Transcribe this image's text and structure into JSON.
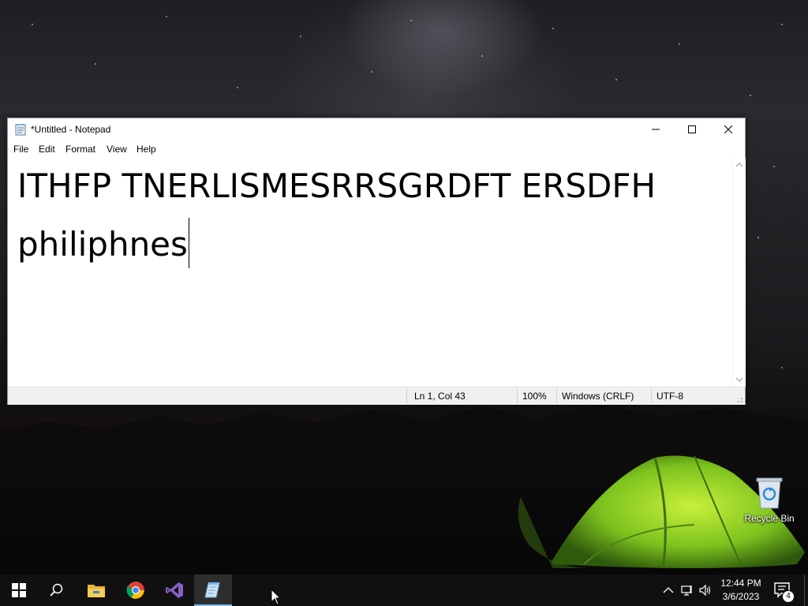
{
  "desktop": {
    "recycle_bin_label": "Recycle Bin"
  },
  "notepad": {
    "title": "*Untitled - Notepad",
    "menu": [
      "File",
      "Edit",
      "Format",
      "View",
      "Help"
    ],
    "content_lines": [
      "ITHFP TNERLISMESRRSGRDFT ERSDFH",
      "philiphnes"
    ],
    "status": {
      "position": "Ln 1, Col 43",
      "zoom": "100%",
      "line_ending": "Windows (CRLF)",
      "encoding": "UTF-8"
    }
  },
  "taskbar": {
    "pinned_apps": [
      "start-icon",
      "search-icon",
      "file-explorer-icon",
      "chrome-icon",
      "visual-studio-icon",
      "notepad-icon"
    ],
    "clock": {
      "time": "12:44 PM",
      "date": "3/6/2023"
    },
    "notification_count": "4"
  },
  "colors": {
    "taskbar_bg": "#101010",
    "active_indicator": "#76b9ed",
    "statusbar_bg": "#f0f0f0"
  }
}
